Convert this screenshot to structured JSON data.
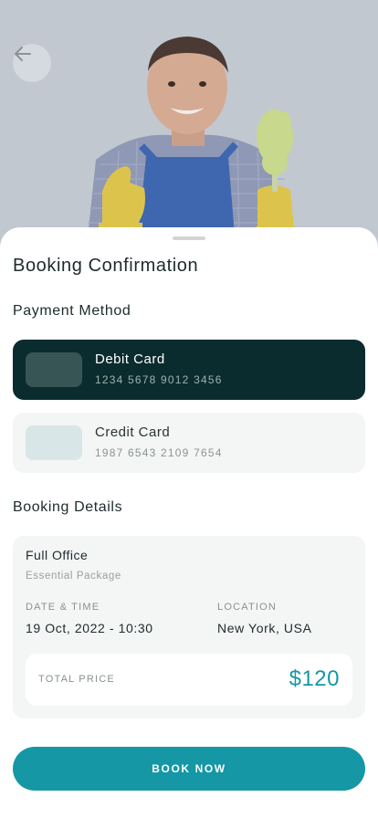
{
  "hero": {
    "image_subject": "cleaner in blue apron holding a yellow duster, thumbs up",
    "back_icon": "arrow-left-icon"
  },
  "sheet": {
    "title": "Booking Confirmation",
    "payment_section_label": "Payment Method",
    "payment_methods": [
      {
        "name": "Debit Card",
        "number": "1234 5678 9012 3456",
        "selected": true
      },
      {
        "name": "Credit Card",
        "number": "1987 6543 2109 7654",
        "selected": false
      }
    ],
    "details_section_label": "Booking Details",
    "details": {
      "service": "Full Office",
      "package": "Essential Package",
      "datetime_label": "DATE & TIME",
      "datetime_value": "19 Oct, 2022 - 10:30",
      "location_label": "LOCATION",
      "location_value": "New York, USA",
      "total_label": "TOTAL PRICE",
      "total_value": "$120"
    },
    "book_button": "BOOK NOW"
  },
  "colors": {
    "accent": "#1597a5",
    "dark_card": "#0b2c2e",
    "light_card": "#f4f5f5",
    "text_dark": "#1d2b2c"
  }
}
